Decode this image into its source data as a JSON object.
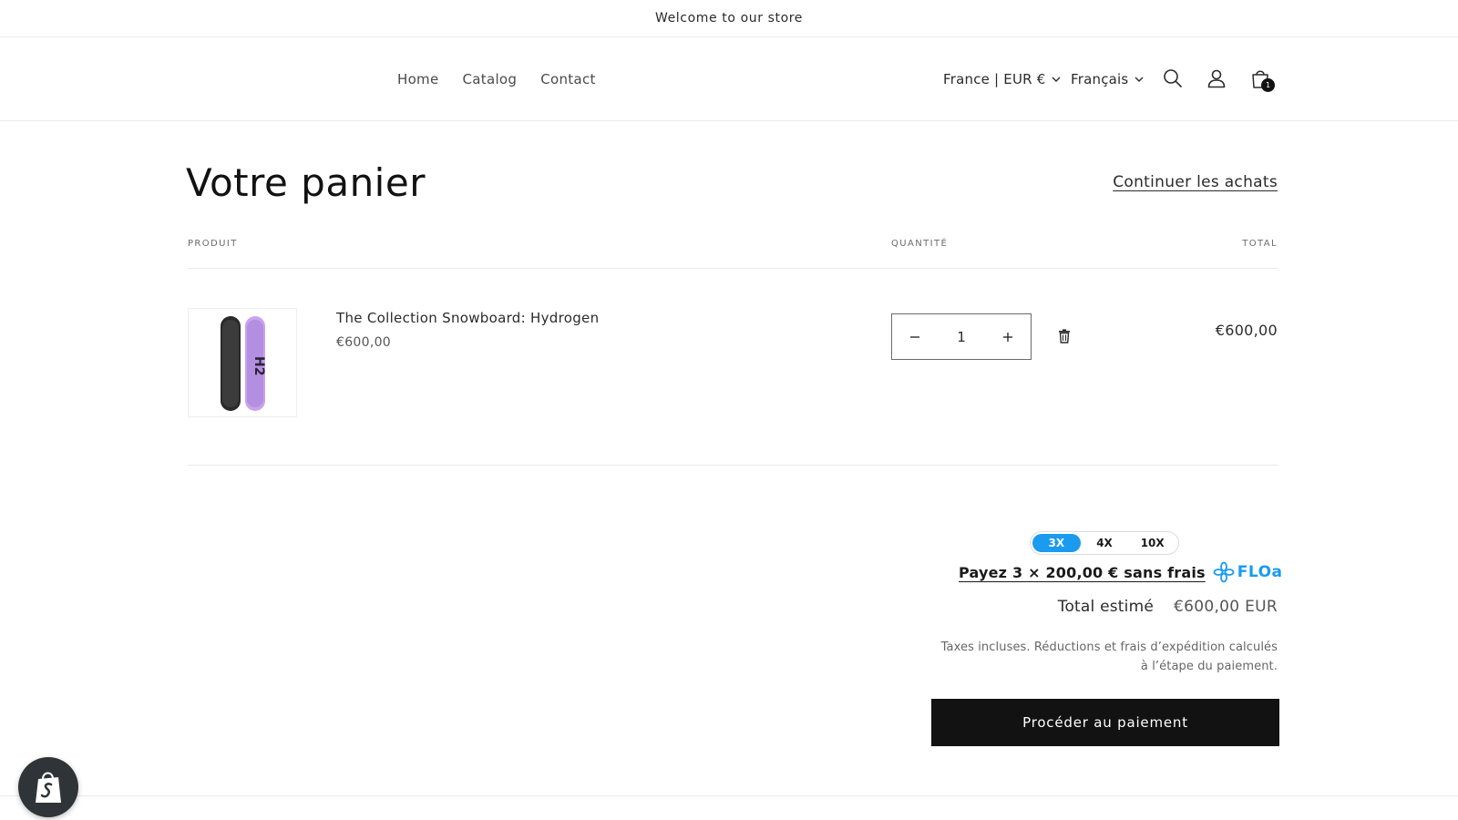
{
  "announcement": {
    "text": "Welcome to our store"
  },
  "header": {
    "nav": [
      {
        "label": "Home"
      },
      {
        "label": "Catalog"
      },
      {
        "label": "Contact"
      }
    ],
    "country_selector": "France | EUR €",
    "language_selector": "Français",
    "icons": [
      "search-icon",
      "account-icon",
      "cart-icon"
    ],
    "cart_count": "1"
  },
  "cart": {
    "title": "Votre panier",
    "continue_link": "Continuer les achats",
    "columns": {
      "product": "PRODUIT",
      "quantity": "QUANTITÉ",
      "total": "TOTAL"
    },
    "items": [
      {
        "name": "The Collection Snowboard: Hydrogen",
        "price": "€600,00",
        "quantity": "1",
        "line_total": "€600,00",
        "image_icon": "snowboard-image"
      }
    ]
  },
  "floa": {
    "tabs": [
      "3X",
      "4X",
      "10X"
    ],
    "active_tab": "3X",
    "text": "Payez 3 × 200,00 € sans frais",
    "brand": "FLOa",
    "brand_color": "#1a9bf0"
  },
  "summary": {
    "total_label": "Total estimé",
    "total_value": "€600,00 EUR",
    "tax_note": "Taxes incluses. Réductions et frais d’expédition calculés à l’étape du paiement.",
    "checkout_label": "Procéder au paiement"
  },
  "colors": {
    "text": "#121212",
    "button_bg": "#121212",
    "shopify_badge": "#2f3438"
  }
}
